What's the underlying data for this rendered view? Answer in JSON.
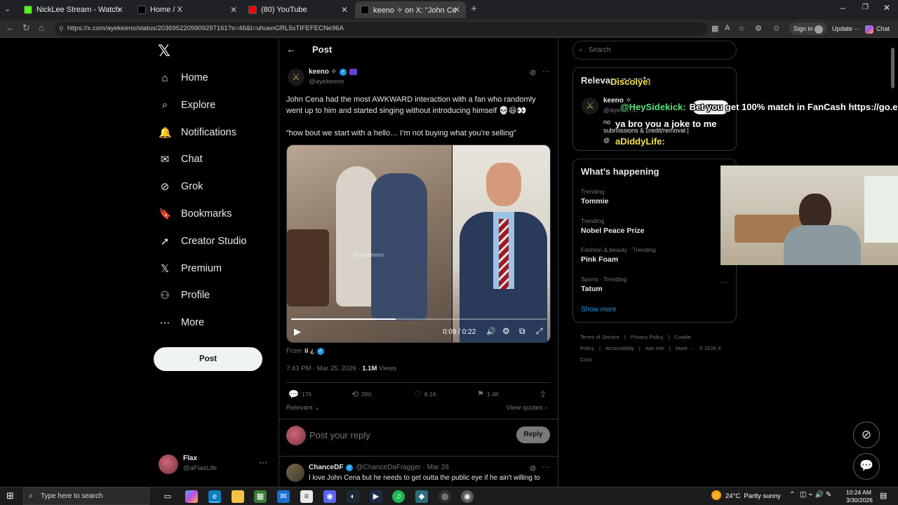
{
  "browser": {
    "tabs": [
      {
        "title": "NickLee Stream - Watch Live on Kick",
        "icon_color": "#53fc18",
        "active": false
      },
      {
        "title": "Home / X",
        "icon_color": "#000000",
        "active": false
      },
      {
        "title": "(80) YouTube",
        "icon_color": "#ff0000",
        "active": false
      },
      {
        "title": "keeno ✧ on X: \"John Cena had the most",
        "icon_color": "#000000",
        "active": true
      }
    ],
    "url": "https://x.com/ayekeeno/status/2036952209909297161?s=46&t=uhuenGRL5sTIFEFECNe96A",
    "sign_in": "Sign in",
    "update": "Update",
    "chat": "Chat"
  },
  "sidebar": {
    "items": [
      {
        "label": "Home",
        "icon": "home-icon",
        "glyph": "⌂"
      },
      {
        "label": "Explore",
        "icon": "search-icon",
        "glyph": "⌕"
      },
      {
        "label": "Notifications",
        "icon": "bell-icon",
        "glyph": "🔔"
      },
      {
        "label": "Chat",
        "icon": "mail-icon",
        "glyph": "✉"
      },
      {
        "label": "Grok",
        "icon": "grok-icon",
        "glyph": "⊘"
      },
      {
        "label": "Bookmarks",
        "icon": "bookmark-icon",
        "glyph": "🔖"
      },
      {
        "label": "Creator Studio",
        "icon": "rocket-icon",
        "glyph": "➚"
      },
      {
        "label": "Premium",
        "icon": "x-premium-icon",
        "glyph": "𝕏"
      },
      {
        "label": "Profile",
        "icon": "person-icon",
        "glyph": "⚇"
      },
      {
        "label": "More",
        "icon": "more-circle-icon",
        "glyph": "⋯"
      }
    ],
    "post_button": "Post",
    "account": {
      "name": "Flax",
      "handle": "@aFlaxLife"
    }
  },
  "post": {
    "header": "Post",
    "author": {
      "name": "keeno ✧",
      "handle": "@ayekeeno"
    },
    "text1": "John Cena had the most AWKWARD interaction with a fan who randomly went up to him and started singing without introducing himself 💀😄👀",
    "text2": "“how bout we start with a hello… I’m not buying what you’re selling”",
    "video": {
      "time": "0:09 / 0:22",
      "progress": 0.41,
      "watermark": "@ayekeeno"
    },
    "from_label": "From",
    "from_name": "ii ¿",
    "meta_time": "7:43 PM · Mar 25, 2026 ·",
    "views_count": "1.1M",
    "views_label": "Views",
    "stats": {
      "replies": "176",
      "reposts": "280",
      "likes": "8.1K",
      "bookmarks": "1.4K"
    },
    "relevant": "Relevant",
    "view_quotes": "View quotes",
    "reply_placeholder": "Post your reply",
    "reply_button": "Reply",
    "reply": {
      "name": "ChanceDF",
      "handle": "@ChanceDaFragger · Mar 26",
      "text": "I love John Cena but he needs to get outta the public eye if he ain't willing to"
    }
  },
  "right": {
    "search_placeholder": "Search",
    "relevant_title": "Relevant people",
    "relevant_person": {
      "name": "keeno ✧",
      "handle": "@ayekeeno",
      "bio_line1": "no",
      "bio_line2": "submissions & credit/removal |",
      "bio_line3": "@",
      "follow": "Follow"
    },
    "happening_title": "What’s happening",
    "trends": [
      {
        "category": "Trending",
        "name": "Tommie"
      },
      {
        "category": "Trending",
        "name": "Nobel Peace Prize"
      },
      {
        "category": "Fashion & beauty · Trending",
        "name": "Pink Foam"
      },
      {
        "category": "Sports · Trending",
        "name": "Tatum"
      }
    ],
    "show_more": "Show more",
    "footer": [
      "Terms of Service",
      "|",
      "Privacy Policy",
      "|",
      "Cookie Policy",
      "|",
      "Accessibility",
      "|",
      "Ads info",
      "|",
      "More ···",
      "© 2026 X Corp."
    ]
  },
  "stream_overlay": {
    "chat": [
      {
        "user": "Discolye:",
        "text": "",
        "color": "#f3e14a"
      },
      {
        "user": "@HeySidekick:",
        "text": "Bet you get 100% match in FanCash https://go.e",
        "color": "#5be37c"
      },
      {
        "user": "",
        "text": "ya bro you a joke to me",
        "color": "#ff5a5a"
      },
      {
        "user": "aDiddyLife:",
        "text": "",
        "color": "#f3e14a"
      }
    ]
  },
  "taskbar": {
    "search_placeholder": "Type here to search",
    "weather": "24°C  Partly sunny",
    "time": "10:24 AM",
    "date": "3/30/2026"
  }
}
